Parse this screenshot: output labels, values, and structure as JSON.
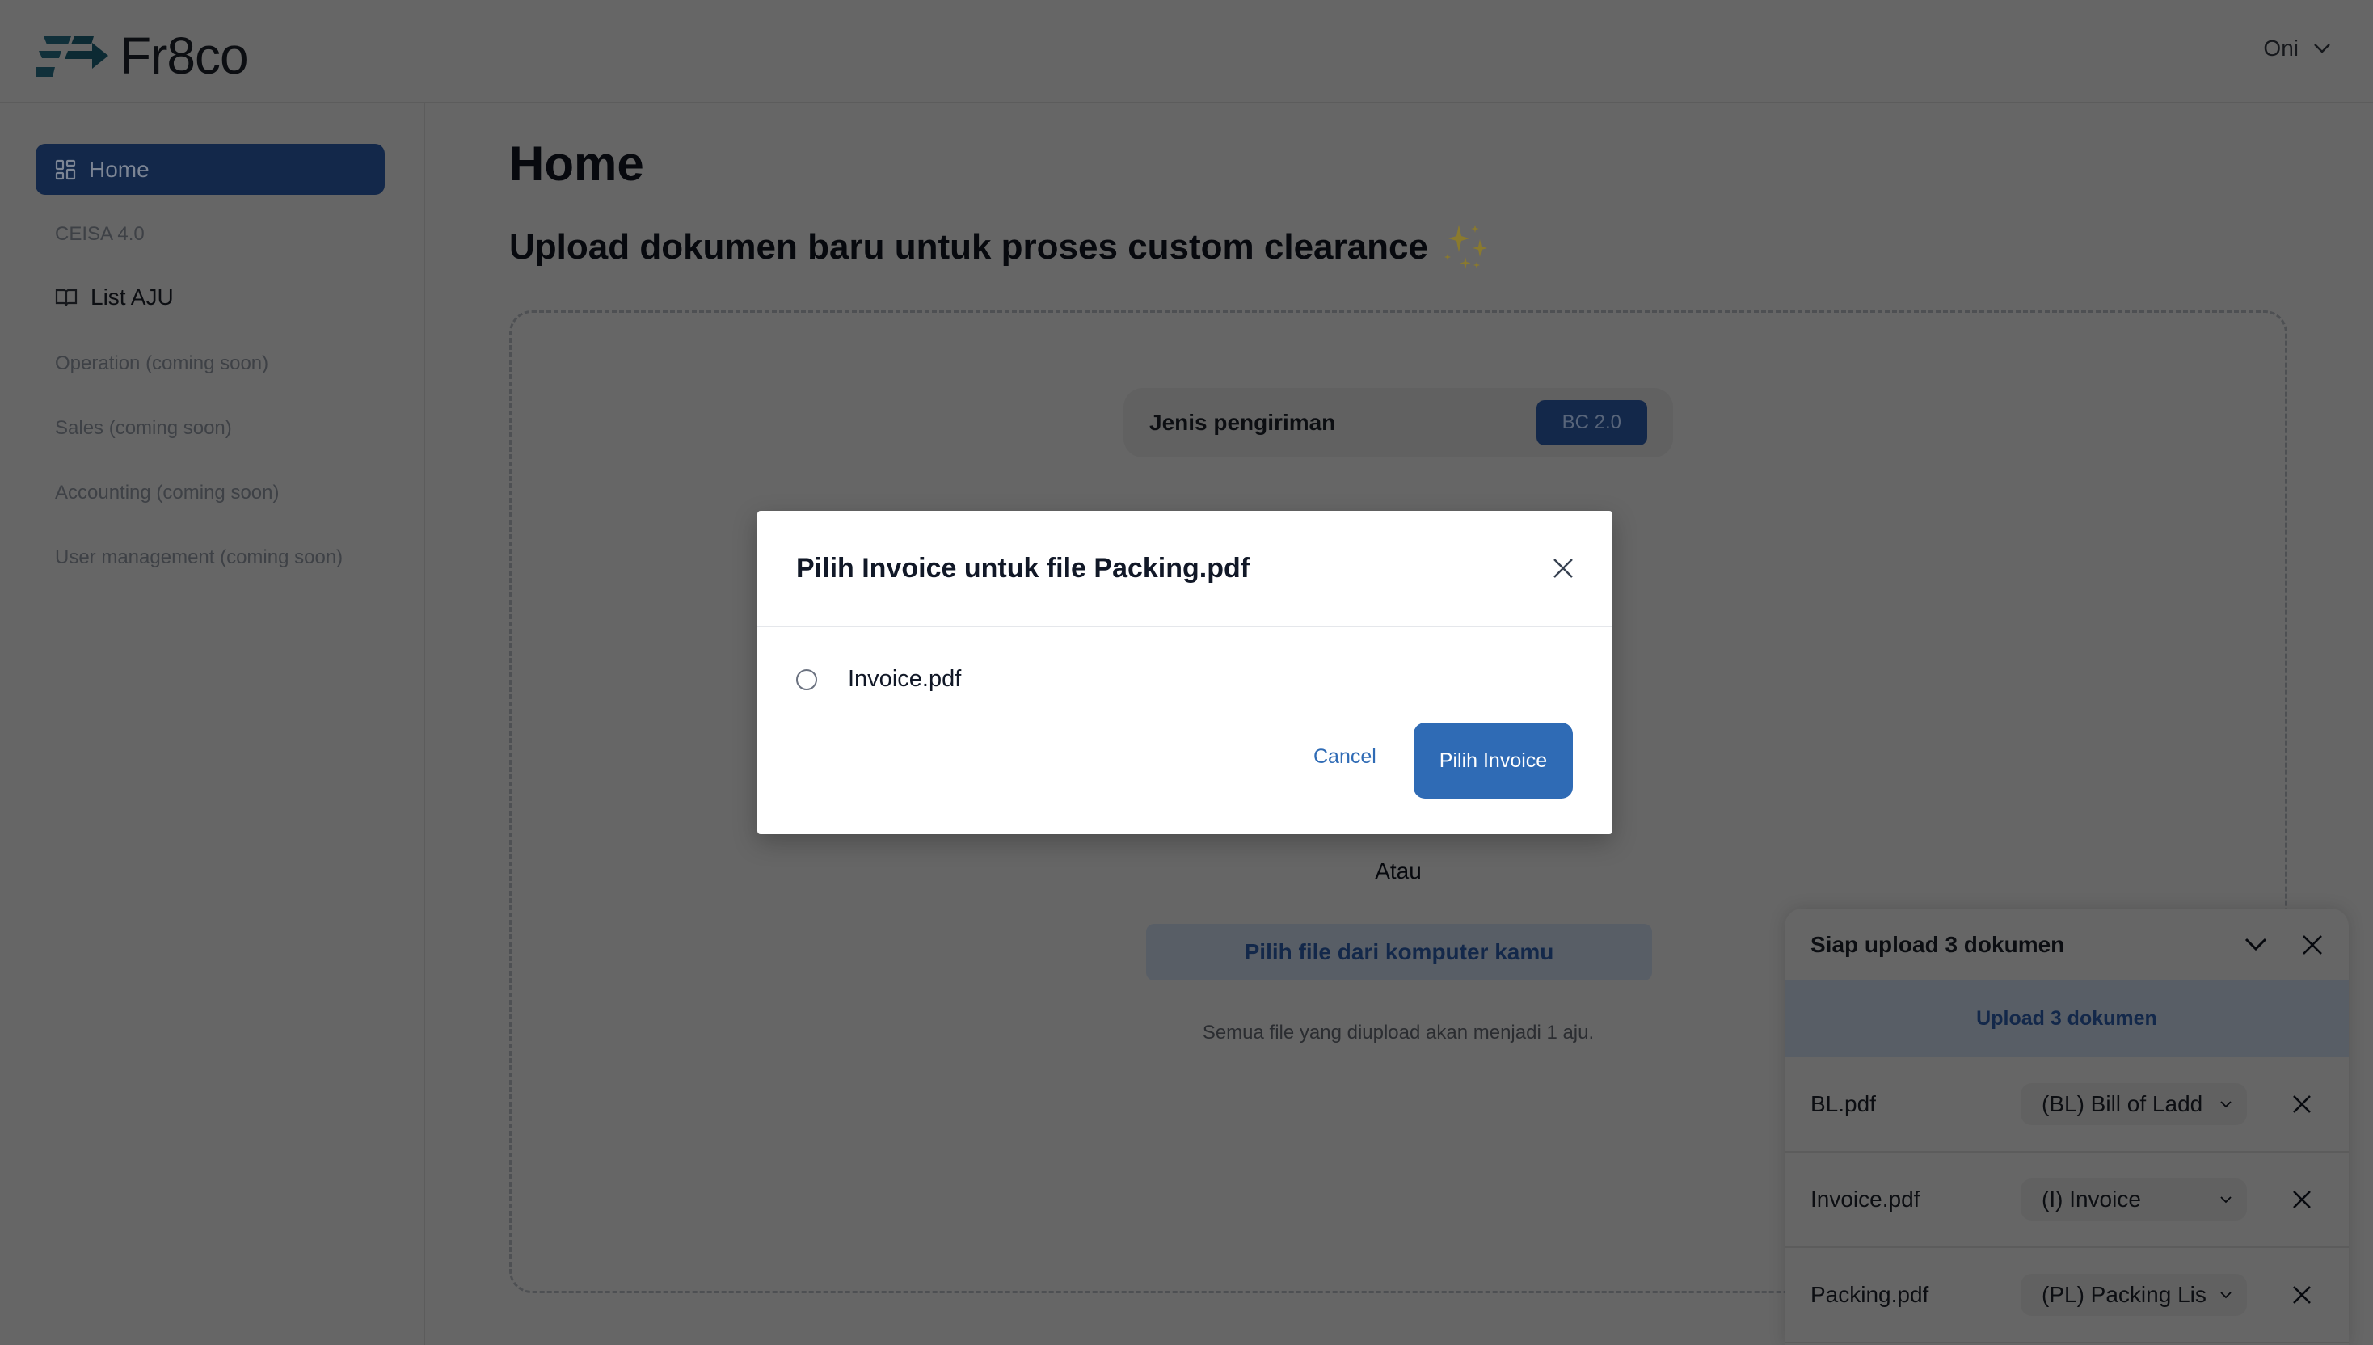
{
  "header": {
    "brand": "Fr8co",
    "user": "Oni",
    "brand_color": "#2a6f82"
  },
  "sidebar": {
    "items": [
      {
        "label": "Home",
        "icon": "grid-icon",
        "active": true
      },
      {
        "label": "CEISA 4.0"
      },
      {
        "label": "List AJU",
        "icon": "book-icon"
      },
      {
        "label": "Operation (coming soon)"
      },
      {
        "label": "Sales (coming soon)"
      },
      {
        "label": "Accounting (coming soon)"
      },
      {
        "label": "User management (coming soon)"
      }
    ]
  },
  "main": {
    "title": "Home",
    "subtitle": "Upload dokumen baru untuk proses custom clearance",
    "shipment_label": "Jenis pengiriman",
    "shipment_value": "BC 2.0",
    "or": "Atau",
    "pick_file": "Pilih file dari komputer kamu",
    "note": "Semua file yang diupload akan menjadi 1 aju."
  },
  "upload_panel": {
    "title": "Siap upload 3 dokumen",
    "upload_button": "Upload 3 dokumen",
    "files": [
      {
        "name": "BL.pdf",
        "type": "(BL) Bill of Ladd"
      },
      {
        "name": "Invoice.pdf",
        "type": "(I) Invoice"
      },
      {
        "name": "Packing.pdf",
        "type": "(PL) Packing Lis"
      }
    ]
  },
  "modal": {
    "title": "Pilih Invoice untuk file Packing.pdf",
    "options": [
      {
        "label": "Invoice.pdf",
        "selected": false
      }
    ],
    "cancel": "Cancel",
    "confirm": "Pilih Invoice",
    "accent": "#2f6bb5"
  }
}
